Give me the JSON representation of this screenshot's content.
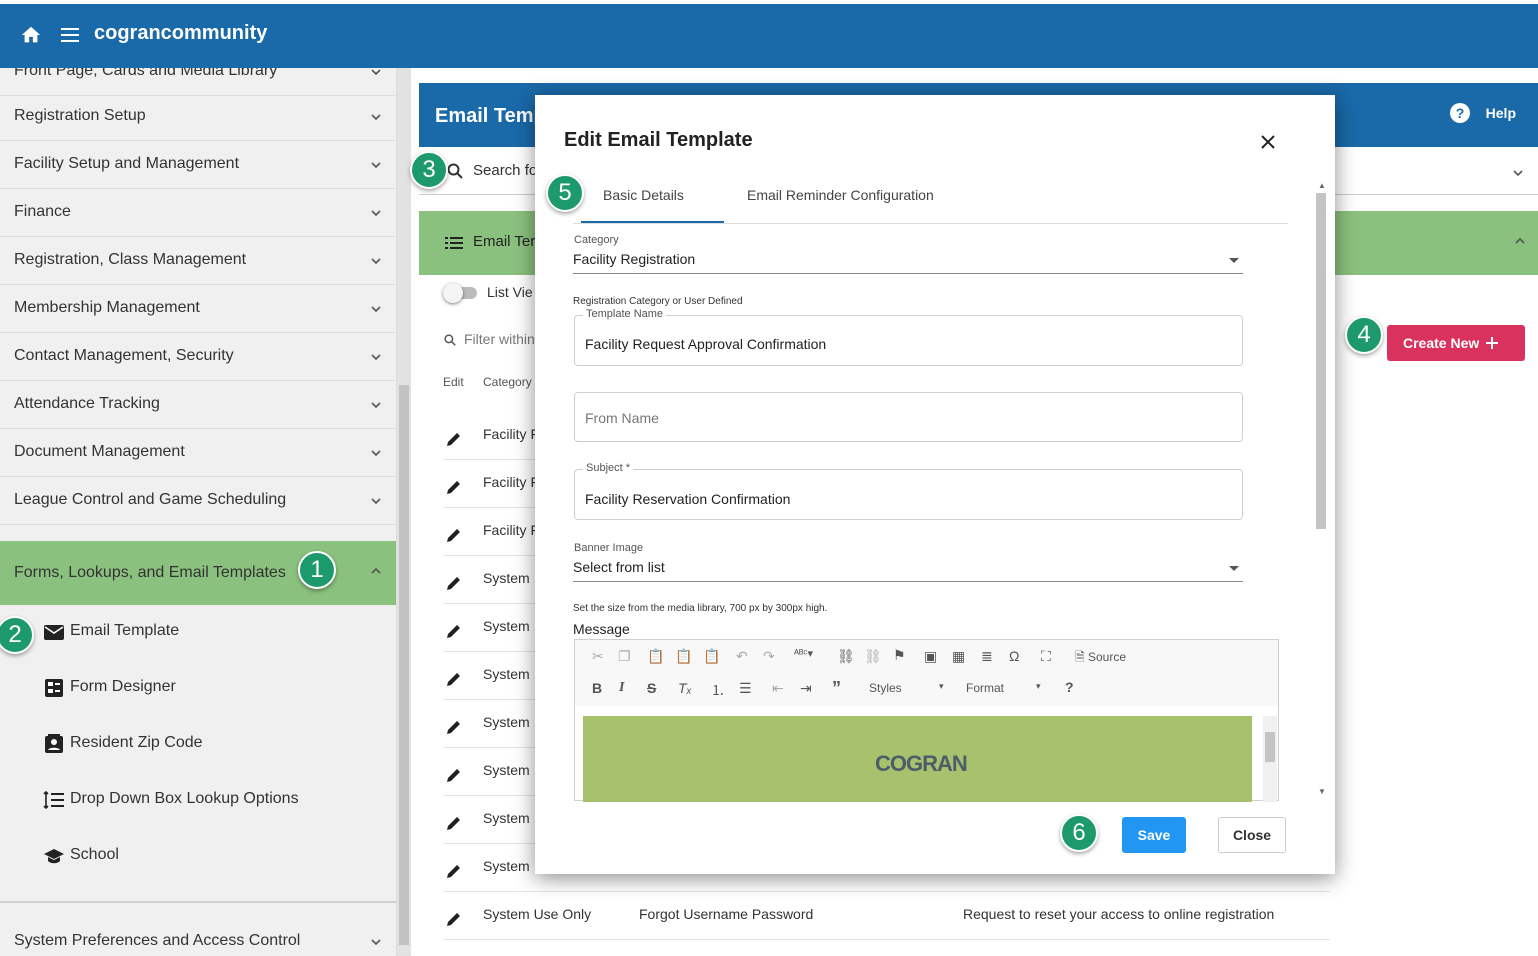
{
  "app": {
    "title": "cograncommunity"
  },
  "sidebar": {
    "items": [
      {
        "label": "Front Page, Cards and Media Library"
      },
      {
        "label": "Registration Setup"
      },
      {
        "label": "Facility Setup and Management"
      },
      {
        "label": "Finance"
      },
      {
        "label": "Registration, Class Management"
      },
      {
        "label": "Membership Management"
      },
      {
        "label": "Contact Management, Security"
      },
      {
        "label": "Attendance Tracking"
      },
      {
        "label": "Document Management"
      },
      {
        "label": "League Control and Game Scheduling"
      }
    ],
    "active": {
      "label": "Forms, Lookups, and Email Templates"
    },
    "subitems": [
      {
        "label": "Email Template",
        "icon": "envelope-icon"
      },
      {
        "label": "Form Designer",
        "icon": "form-icon"
      },
      {
        "label": "Resident Zip Code",
        "icon": "contact-card-icon"
      },
      {
        "label": "Drop Down Box Lookup Options",
        "icon": "list-icon"
      },
      {
        "label": "School",
        "icon": "school-icon"
      }
    ],
    "bottom": {
      "label": "System Preferences and Access Control"
    }
  },
  "main": {
    "header_title": "Email Temp",
    "help_label": "Help",
    "search_placeholder": "Search fo",
    "section_title": "Email Ter",
    "list_view_label": "List Vie",
    "filter_placeholder": "Filter within",
    "col_edit": "Edit",
    "col_category": "Category",
    "create_new_label": "Create New",
    "rows": [
      {
        "c1": "Facility F"
      },
      {
        "c1": "Facility F"
      },
      {
        "c1": "Facility F"
      },
      {
        "c1": "System"
      },
      {
        "c1": "System"
      },
      {
        "c1": "System"
      },
      {
        "c1": "System"
      },
      {
        "c1": "System"
      },
      {
        "c1": "System"
      },
      {
        "c1": "System"
      },
      {
        "c1": "System Use Only",
        "c2": "Forgot Username Password",
        "c3": "Request to reset your access to online registration"
      }
    ]
  },
  "modal": {
    "title": "Edit Email Template",
    "tabs": [
      "Basic Details",
      "Email Reminder Configuration"
    ],
    "category_label": "Category",
    "category_value": "Facility Registration",
    "reg_category_label": "Registration Category or User Defined",
    "template_name_label": "Template Name",
    "template_name_value": "Facility Request Approval Confirmation",
    "from_name_placeholder": "From Name",
    "subject_label": "Subject *",
    "subject_value": "Facility Reservation Confirmation",
    "banner_label": "Banner Image",
    "banner_value": "Select from list",
    "banner_hint": "Set the size from the media library, 700 px by 300px high.",
    "message_label": "Message",
    "toolbar": {
      "source": "Source",
      "styles": "Styles",
      "format": "Format",
      "help": "?"
    },
    "banner_logo_text": "COGRAN",
    "save_label": "Save",
    "close_label": "Close"
  },
  "badges": [
    "1",
    "2",
    "3",
    "4",
    "5",
    "6"
  ],
  "colors": {
    "topbar": "#1a69a9",
    "active_green": "#8bc17e",
    "create_new": "#d9325e",
    "save": "#2196f3",
    "badge": "#1d9a6c"
  }
}
